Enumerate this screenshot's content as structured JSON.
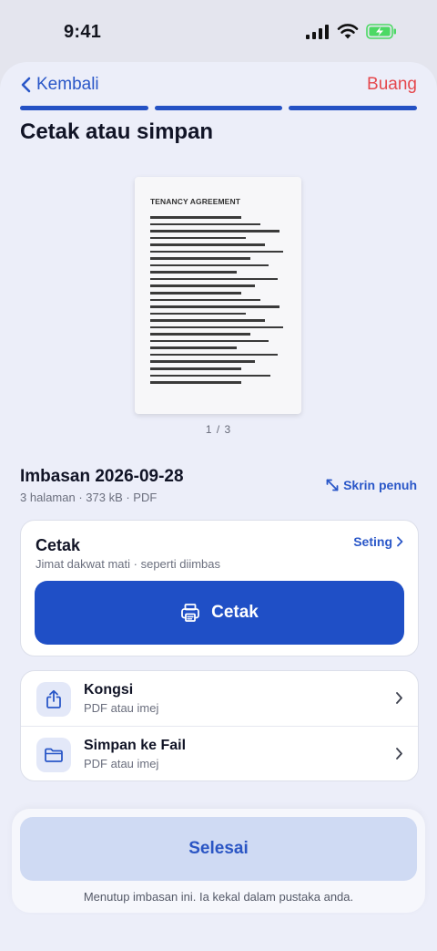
{
  "status": {
    "time": "9:41"
  },
  "nav": {
    "back_label": "Kembali",
    "discard_label": "Buang"
  },
  "page": {
    "title": "Cetak atau simpan"
  },
  "preview": {
    "doc_heading": "TENANCY AGREEMENT",
    "page_indicator": "1 / 3"
  },
  "scan": {
    "name": "Imbasan 2026-09-28",
    "meta": "3 halaman · 373 kB · PDF",
    "fullscreen_label": "Skrin penuh"
  },
  "print": {
    "title": "Cetak",
    "subtitle": "Jimat dakwat mati · seperti diimbas",
    "settings_label": "Seting",
    "button_label": "Cetak"
  },
  "actions": [
    {
      "title": "Kongsi",
      "subtitle": "PDF atau imej",
      "icon": "share-icon"
    },
    {
      "title": "Simpan ke Fail",
      "subtitle": "PDF atau imej",
      "icon": "folder-icon"
    }
  ],
  "footer": {
    "done_label": "Selesai",
    "note": "Menutup imbasan ini. Ia kekal dalam pustaka anda."
  },
  "colors": {
    "accent": "#1f4fc6",
    "destructive": "#e5484d",
    "battery": "#4cd964"
  }
}
